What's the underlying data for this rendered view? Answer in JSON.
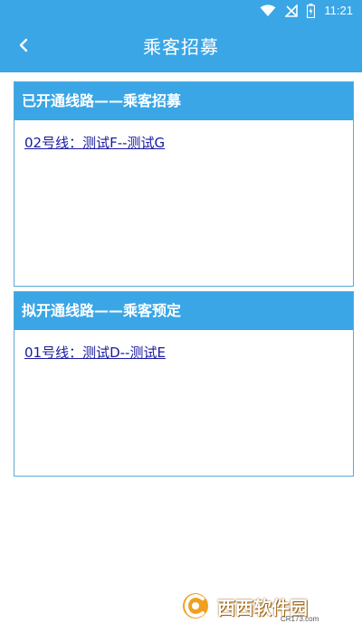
{
  "status_bar": {
    "time": "11:21",
    "icons": [
      "wifi-icon",
      "signal-off-icon",
      "battery-charging-icon"
    ]
  },
  "header": {
    "title": "乘客招募",
    "back_icon": "chevron-left-icon"
  },
  "sections": [
    {
      "title": "已开通线路——乘客招募",
      "items": [
        {
          "label": "02号线：测试F--测试G"
        }
      ]
    },
    {
      "title": "拟开通线路——乘客预定",
      "items": [
        {
          "label": "01号线：测试D--测试E"
        }
      ]
    }
  ],
  "watermark": {
    "text": "西西软件园",
    "sub": "CR173.com"
  },
  "colors": {
    "primary": "#3aa6e6",
    "link": "#1a1aa0",
    "border": "#5aa9d8"
  }
}
